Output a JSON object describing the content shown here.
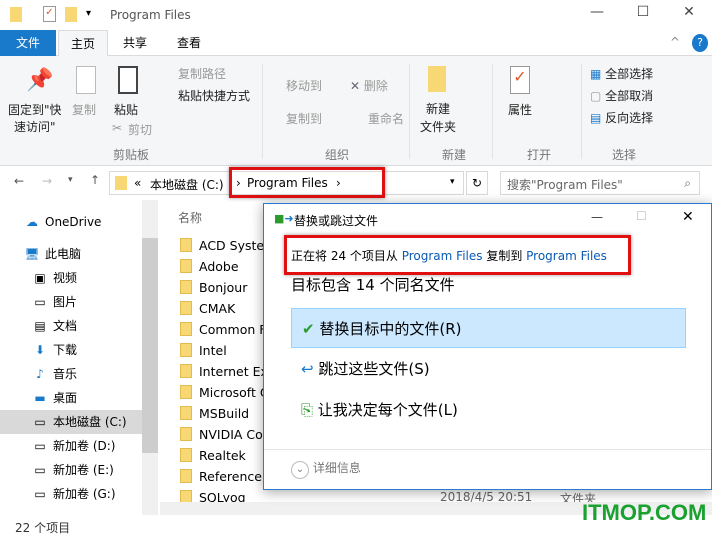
{
  "window": {
    "title": "Program Files",
    "minimize": "—",
    "maximize": "☐",
    "close": "✕"
  },
  "tabs": [
    "文件",
    "主页",
    "共享",
    "查看"
  ],
  "ribbon": {
    "clipboard": {
      "pin": "固定到\"快",
      "pin2": "速访问\"",
      "copy": "复制",
      "paste": "粘贴",
      "copy_path": "复制路径",
      "paste_shortcut": "粘贴快捷方式",
      "cut": "剪切",
      "group": "剪贴板"
    },
    "organize": {
      "move_to": "移动到",
      "copy_to": "复制到",
      "delete": "删除",
      "rename": "重命名",
      "group": "组织"
    },
    "new": {
      "new_folder": "新建",
      "new_folder2": "文件夹",
      "group": "新建"
    },
    "open": {
      "properties": "属性",
      "group": "打开"
    },
    "select": {
      "select_all": "全部选择",
      "select_none": "全部取消",
      "invert": "反向选择",
      "group": "选择"
    }
  },
  "address": {
    "prefix": "«",
    "crumbs": [
      "本地磁盘 (C:)",
      "Program Files"
    ],
    "search_placeholder": "搜索\"Program Files\""
  },
  "nav": [
    {
      "label": "OneDrive",
      "icon": "cloud-icon"
    },
    {
      "label": "此电脑",
      "icon": "computer-icon"
    },
    {
      "label": "视频",
      "icon": "video-icon"
    },
    {
      "label": "图片",
      "icon": "pictures-icon"
    },
    {
      "label": "文档",
      "icon": "documents-icon"
    },
    {
      "label": "下载",
      "icon": "download-icon"
    },
    {
      "label": "音乐",
      "icon": "music-icon"
    },
    {
      "label": "桌面",
      "icon": "desktop-icon"
    },
    {
      "label": "本地磁盘 (C:)",
      "icon": "drive-icon",
      "selected": true
    },
    {
      "label": "新加卷 (D:)",
      "icon": "drive-icon"
    },
    {
      "label": "新加卷 (E:)",
      "icon": "drive-icon"
    },
    {
      "label": "新加卷 (G:)",
      "icon": "drive-icon"
    }
  ],
  "files": {
    "column_name": "名称",
    "items": [
      "ACD Systen",
      "Adobe",
      "Bonjour",
      "CMAK",
      "Common F",
      "Intel",
      "Internet Exp",
      "Microsoft O",
      "MSBuild",
      "NVIDIA Co",
      "Realtek",
      "Reference A",
      "SQLyog"
    ],
    "last_date": "2018/4/5 20:51",
    "last_type": "文件夹"
  },
  "status": {
    "count": "22 个项目"
  },
  "dialog": {
    "title": "替换或跳过文件",
    "msg_a": "正在将 24 个项目从 ",
    "src": "Program Files",
    "msg_b": " 复制到 ",
    "dst": "Program Files",
    "heading": "目标包含 14 个同名文件",
    "replace": "替换目标中的文件(R)",
    "skip": "跳过这些文件(S)",
    "decide": "让我决定每个文件(L)",
    "details": "详细信息"
  },
  "watermark": "ITMOP.COM"
}
